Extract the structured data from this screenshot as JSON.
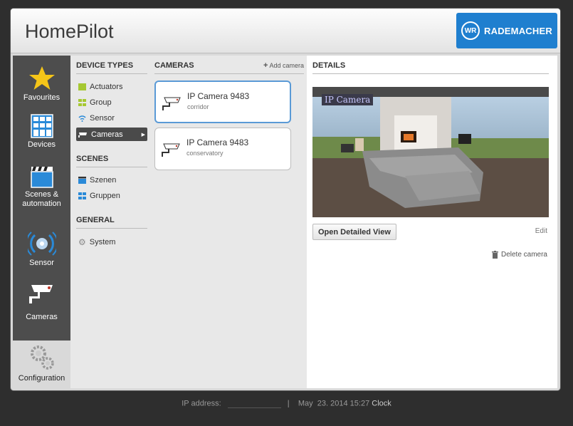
{
  "app": {
    "title": "HomePilot",
    "brand": "RADEMACHER"
  },
  "sidebar": {
    "items": [
      {
        "label": "Favourites",
        "icon": "star-icon"
      },
      {
        "label": "Devices",
        "icon": "devices-icon"
      },
      {
        "label": "Scenes & automation",
        "icon": "clapperboard-icon"
      },
      {
        "label": "Sensor",
        "icon": "sensor-waves-icon"
      },
      {
        "label": "Cameras",
        "icon": "camera-icon"
      }
    ],
    "config_label": "Configuration"
  },
  "device_types": {
    "heading": "DEVICE TYPES",
    "items": [
      {
        "label": "Actuators",
        "color": "#a6c832"
      },
      {
        "label": "Group",
        "color": "#a6c832"
      },
      {
        "label": "Sensor",
        "color": "#2a8ad8"
      },
      {
        "label": "Cameras",
        "color": "#ffffff"
      }
    ]
  },
  "scenes": {
    "heading": "SCENES",
    "items": [
      {
        "label": "Szenen"
      },
      {
        "label": "Gruppen"
      }
    ]
  },
  "general": {
    "heading": "GENERAL",
    "items": [
      {
        "label": "System"
      }
    ]
  },
  "cameras": {
    "heading": "CAMERAS",
    "add_label": "Add camera",
    "list": [
      {
        "name": "IP Camera 9483",
        "location": "corridor"
      },
      {
        "name": "IP Camera 9483",
        "location": "conservatory"
      }
    ]
  },
  "details": {
    "heading": "DETAILS",
    "overlay_text": "IP Camera",
    "open_button": "Open Detailed View",
    "edit_label": "Edit",
    "delete_label": "Delete camera"
  },
  "footer": {
    "ip_label": "IP address:",
    "separator": "|",
    "date": "May  23. 2014 15:27",
    "clock_label": "Clock"
  }
}
